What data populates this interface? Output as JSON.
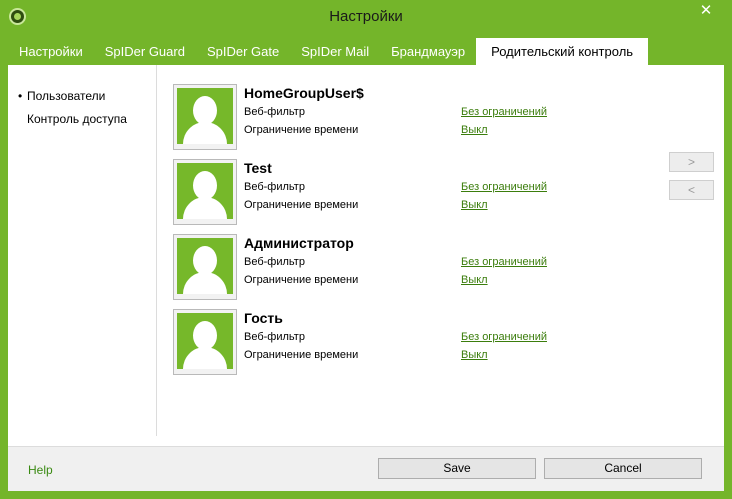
{
  "window": {
    "title": "Настройки",
    "close_glyph": "✕",
    "app_icon": "dr-web-spider-icon",
    "accent_color": "#74b52a",
    "link_color": "#3b7d0c"
  },
  "tabs": [
    {
      "label": "Настройки",
      "active": false
    },
    {
      "label": "SpIDer Guard",
      "active": false
    },
    {
      "label": "SpIDer Gate",
      "active": false
    },
    {
      "label": "SpIDer Mail",
      "active": false
    },
    {
      "label": "Брандмауэр",
      "active": false
    },
    {
      "label": "Родительский контроль",
      "active": true
    }
  ],
  "sidebar": {
    "items": [
      {
        "label": "Пользователи",
        "bullet": "•",
        "selected": true
      },
      {
        "label": "Контроль доступа",
        "bullet": "",
        "selected": false
      }
    ]
  },
  "users": [
    {
      "name": "HomeGroupUser$",
      "web_filter_label": "Веб-фильтр",
      "web_filter_value": "Без ограничений",
      "time_label": "Ограничение времени",
      "time_value": "Выкл"
    },
    {
      "name": "Test",
      "web_filter_label": "Веб-фильтр",
      "web_filter_value": "Без ограничений",
      "time_label": "Ограничение времени",
      "time_value": "Выкл"
    },
    {
      "name": "Администратор",
      "web_filter_label": "Веб-фильтр",
      "web_filter_value": "Без ограничений",
      "time_label": "Ограничение времени",
      "time_value": "Выкл"
    },
    {
      "name": "Гость",
      "web_filter_label": "Веб-фильтр",
      "web_filter_value": "Без ограничений",
      "time_label": "Ограничение времени",
      "time_value": "Выкл"
    }
  ],
  "nav": {
    "next_label": ">",
    "prev_label": "<"
  },
  "footer": {
    "help_label": "Help",
    "save_label": "Save",
    "cancel_label": "Cancel"
  }
}
